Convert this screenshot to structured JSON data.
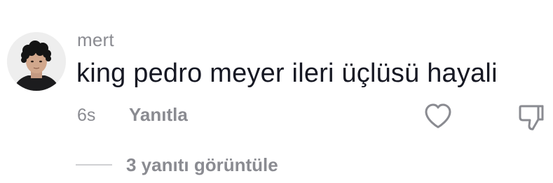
{
  "comment": {
    "avatar_icon": "user-avatar-photo",
    "username": "mert",
    "text": "king pedro meyer ileri üçlüsü hayali",
    "timestamp": "6s",
    "reply_label": "Yanıtla",
    "like_icon": "heart-outline-icon",
    "dislike_icon": "thumbs-down-icon",
    "view_replies_label": "3 yanıtı görüntüle"
  },
  "colors": {
    "text_primary": "#161823",
    "text_secondary": "#8a8b91",
    "divider": "#d0d1d3",
    "background": "#ffffff"
  }
}
